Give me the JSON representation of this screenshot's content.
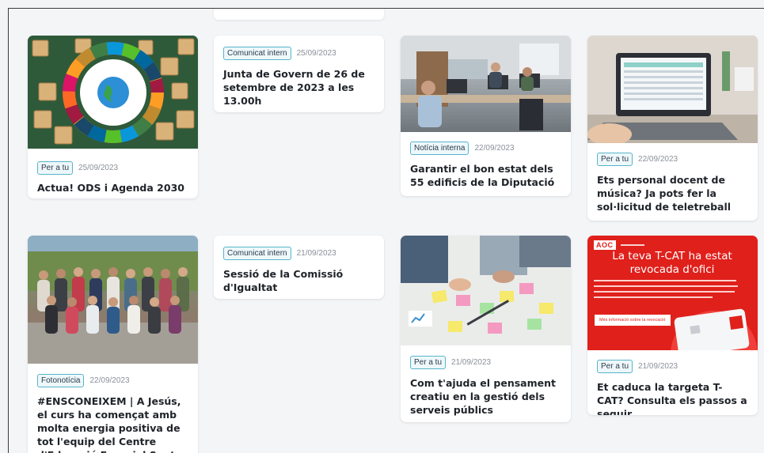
{
  "cards": [
    {
      "badge": "Per a tu",
      "date": "25/09/2023",
      "title": "Actua! ODS i Agenda 2030"
    },
    {
      "badge": "Comunicat intern",
      "date": "25/09/2023",
      "title": "Junta de Govern de 26 de setembre de 2023 a les 13.00h"
    },
    {
      "badge": "Notícia interna",
      "date": "22/09/2023",
      "title": "Garantir el bon estat dels 55 edificis de la Diputació"
    },
    {
      "badge": "Per a tu",
      "date": "22/09/2023",
      "title": "Ets personal docent de música? Ja pots fer la sol·licitud de teletreball"
    },
    {
      "badge": "Fotonotícia",
      "date": "22/09/2023",
      "title": "#ENSCONEIXEM | A Jesús, el curs ha començat amb molta energia positiva de tot l'equip del Centre d'Educació Especial Sant Jordi"
    },
    {
      "badge": "Comunicat intern",
      "date": "21/09/2023",
      "title": "Sessió de la Comissió d'Igualtat"
    },
    {
      "badge": "Per a tu",
      "date": "21/09/2023",
      "title": "Com t'ajuda el pensament creatiu en la gestió dels serveis públics"
    },
    {
      "badge": "Per a tu",
      "date": "21/09/2023",
      "title": "Et caduca la targeta T-CAT? Consulta els passos a seguir"
    }
  ],
  "tcat_banner": {
    "logo": "AOC",
    "headline": "La teva T-CAT ha estat revocada d'ofici",
    "button": "Més informació sobre la revocació"
  },
  "colors": {
    "badge_border": "#57b4c9",
    "tcat_red": "#e0201b"
  }
}
